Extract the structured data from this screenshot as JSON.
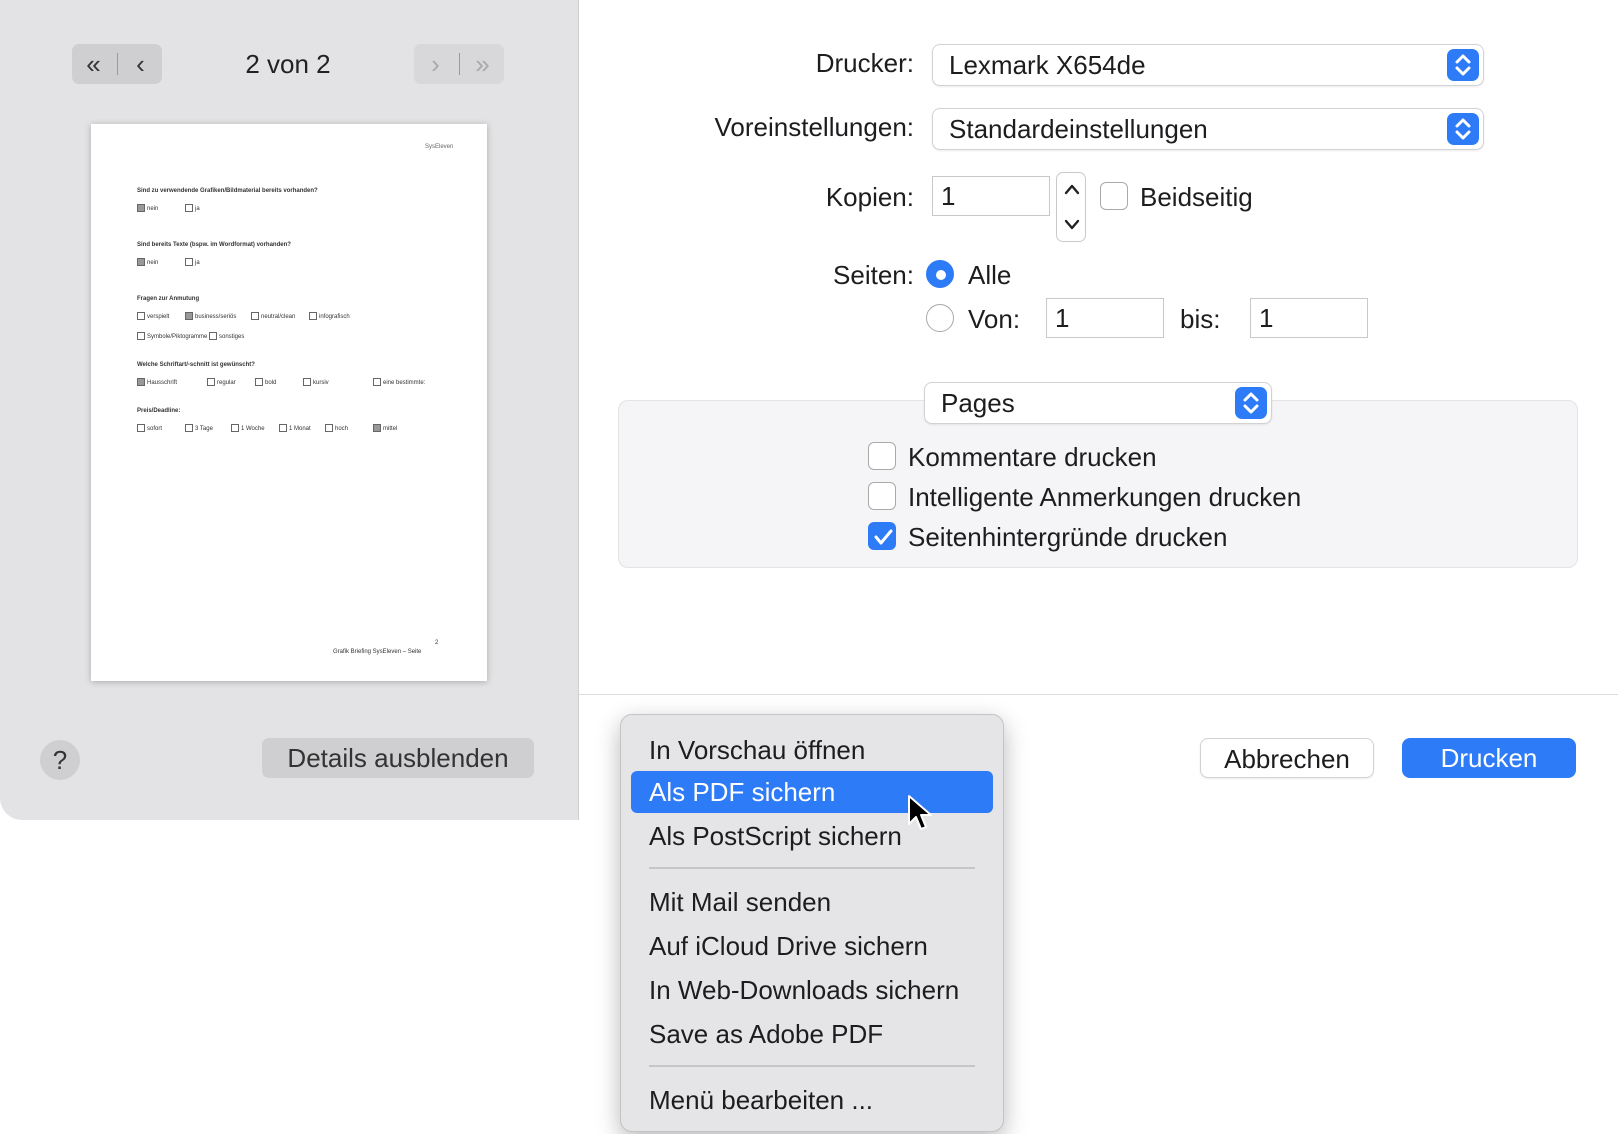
{
  "preview": {
    "page_counter": "2 von 2",
    "nav_first_icon": "double-chevron-left-icon",
    "nav_prev_icon": "chevron-left-icon",
    "nav_next_icon": "chevron-right-icon",
    "nav_last_icon": "double-chevron-right-icon",
    "doc_logo_text": "SysEleven",
    "questions": [
      {
        "text": "Sind zu verwendende Grafiken/Bildmaterial bereits vorhanden?",
        "options": [
          "nein",
          "ja"
        ]
      },
      {
        "text": "Sind bereits Texte (bspw. im Wordformat) vorhanden?",
        "options": [
          "nein",
          "ja"
        ]
      },
      {
        "text": "Fragen zur Anmutung",
        "options": [
          "verspielt",
          "business/seriös",
          "neutral/clean",
          "infografisch",
          "Symbole/Piktogramme",
          "sonstiges"
        ]
      },
      {
        "text": "Welche Schriftart/-schnitt ist gewünscht?",
        "options": [
          "Hausschrift",
          "regular",
          "bold",
          "kursiv",
          "eine bestimmte:"
        ]
      },
      {
        "text": "Preis/Deadline:",
        "options": [
          "sofort",
          "3 Tage",
          "1 Woche",
          "1 Monat",
          "hoch",
          "mittel"
        ]
      }
    ],
    "footer": "Grafik Briefing SysEleven – Seite",
    "footer_page": "2"
  },
  "left_footer": {
    "help_label": "?",
    "details_label": "Details ausblenden"
  },
  "form": {
    "printer_label": "Drucker:",
    "printer_value": "Lexmark X654de",
    "presets_label": "Voreinstellungen:",
    "presets_value": "Standardeinstellungen",
    "copies_label": "Kopien:",
    "copies_value": "1",
    "duplex_label": "Beidseitig",
    "duplex_checked": false,
    "pages_label": "Seiten:",
    "pages_all_label": "Alle",
    "pages_all_selected": true,
    "pages_from_label": "Von:",
    "pages_from_value": "1",
    "pages_to_label": "bis:",
    "pages_to_value": "1"
  },
  "app_section": {
    "popup_value": "Pages",
    "options": [
      {
        "label": "Kommentare drucken",
        "checked": false
      },
      {
        "label": "Intelligente Anmerkungen drucken",
        "checked": false
      },
      {
        "label": "Seitenhintergründe drucken",
        "checked": true
      }
    ]
  },
  "buttons": {
    "cancel": "Abbrechen",
    "print": "Drucken"
  },
  "pdf_menu": {
    "items": [
      "In Vorschau öffnen",
      "Als PDF sichern",
      "Als PostScript sichern",
      "Mit Mail senden",
      "Auf iCloud Drive sichern",
      "In Web-Downloads sichern",
      "Save as Adobe PDF",
      "Menü bearbeiten ..."
    ],
    "highlighted": "Als PDF sichern"
  },
  "colors": {
    "accent": "#2d7bf6",
    "sidebar_bg": "#e3e3e5",
    "menu_bg": "#e5e5e7"
  }
}
